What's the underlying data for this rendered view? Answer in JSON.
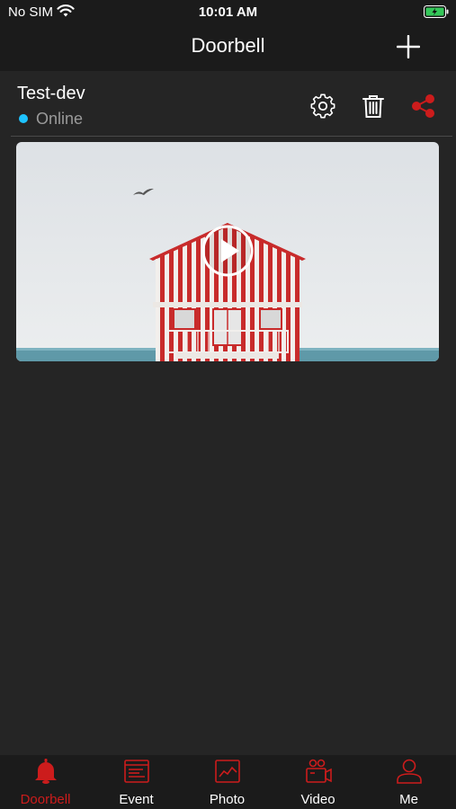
{
  "status_bar": {
    "carrier": "No SIM",
    "time": "10:01 AM"
  },
  "nav": {
    "title": "Doorbell",
    "add_icon": "plus-icon"
  },
  "device": {
    "name": "Test-dev",
    "status": "Online",
    "status_color": "#1ec3ff",
    "actions": [
      "gear-icon",
      "trash-icon",
      "share-icon"
    ]
  },
  "tabs": [
    {
      "label": "Doorbell",
      "icon": "bell-icon",
      "active": true
    },
    {
      "label": "Event",
      "icon": "event-list-icon",
      "active": false
    },
    {
      "label": "Photo",
      "icon": "photo-icon",
      "active": false
    },
    {
      "label": "Video",
      "icon": "video-camera-icon",
      "active": false
    },
    {
      "label": "Me",
      "icon": "user-icon",
      "active": false
    }
  ],
  "colors": {
    "accent": "#cc1c1c",
    "background": "#252525",
    "bar": "#1b1b1b"
  }
}
